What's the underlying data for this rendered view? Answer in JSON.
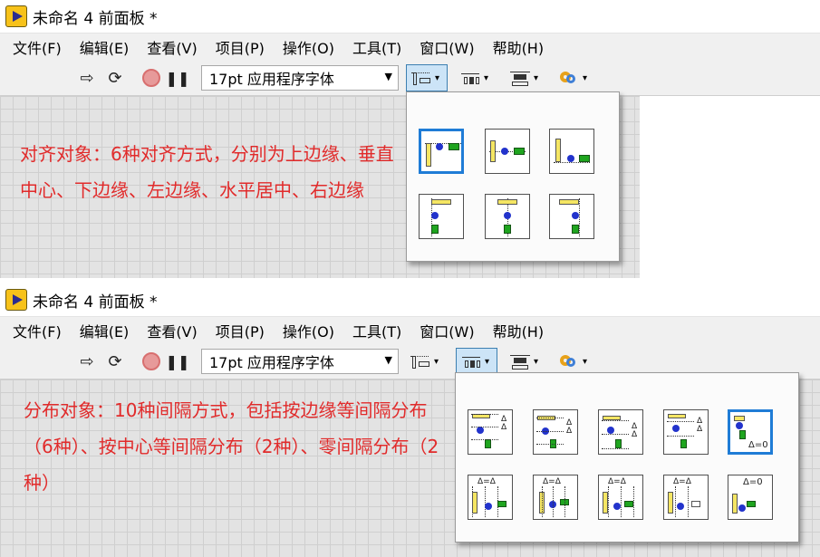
{
  "window": {
    "title": "未命名 4 前面板 *",
    "menus": [
      "文件(F)",
      "编辑(E)",
      "查看(V)",
      "项目(P)",
      "操作(O)",
      "工具(T)",
      "窗口(W)",
      "帮助(H)"
    ]
  },
  "toolbar": {
    "run_icon": "run-arrow-icon",
    "continuous_icon": "run-continuously-icon",
    "stop_icon": "abort-icon",
    "pause_icon": "pause-icon",
    "font_value": "17pt 应用程序字体",
    "align_icon": "align-objects-icon",
    "distribute_icon": "distribute-objects-icon",
    "resize_icon": "resize-objects-icon",
    "reorder_icon": "reorder-icon",
    "run_glyph": "⇨",
    "continuous_glyph": "⟳",
    "pause_glyph": "❚❚",
    "caret_glyph": "▾"
  },
  "panel1": {
    "note": "对齐对象：6种对齐方式，分别为上边缘、垂直中心、下边缘、左边缘、水平居中、右边缘",
    "palette": "align",
    "active_tool": "align"
  },
  "panel2": {
    "note": "分布对象：10种间隔方式，包括按边缘等间隔分布（6种）、按中心等间隔分布（2种）、零间隔分布（2种）",
    "palette": "distribute",
    "active_tool": "distribute"
  },
  "align_palette": {
    "selected_index": 0,
    "items": [
      "align-top-edges-icon",
      "align-vertical-centers-icon",
      "align-bottom-edges-icon",
      "align-left-edges-icon",
      "align-horizontal-centers-icon",
      "align-right-edges-icon"
    ]
  },
  "distribute_palette": {
    "selected_index": 4,
    "items": [
      "distribute-top-edges-icon",
      "distribute-vertical-centers-icon",
      "distribute-bottom-edges-icon",
      "distribute-vertical-gap-icon",
      "distribute-vertical-compress-icon",
      "distribute-left-edges-icon",
      "distribute-horizontal-centers-icon",
      "distribute-right-edges-icon",
      "distribute-horizontal-gap-icon",
      "distribute-horizontal-compress-icon"
    ],
    "delta_equal_label": "Δ=Δ",
    "delta_zero_label": "Δ=0"
  },
  "colors": {
    "note_red": "#e12b2b",
    "selection_blue": "#1f7cd6",
    "canvas_grid": "#e3e3e3"
  }
}
